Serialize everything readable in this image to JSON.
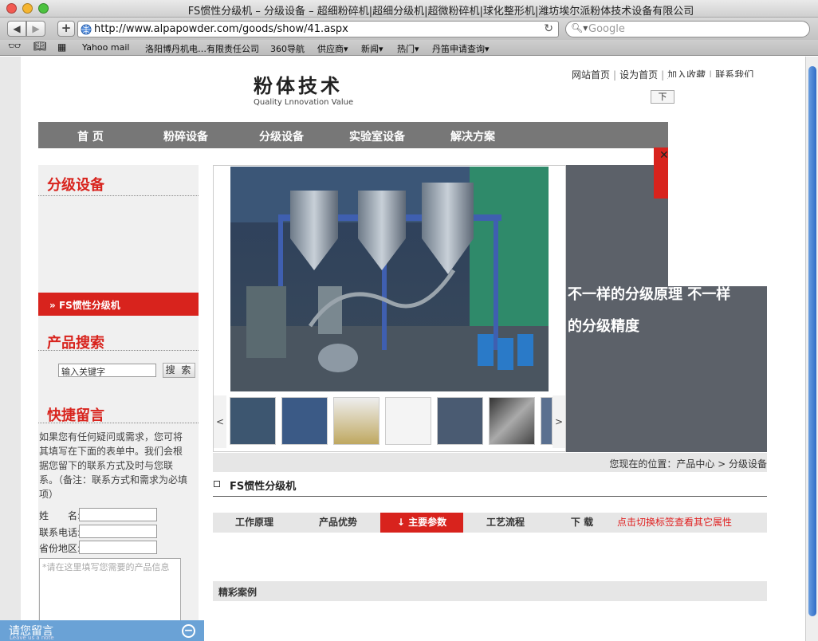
{
  "browser": {
    "title": "FS惯性分级机 – 分级设备 – 超细粉碎机|超细分级机|超微粉碎机|球化整形机|潍坊埃尔派粉体技术设备有限公司",
    "url": "http://www.alpapowder.com/goods/show/41.aspx",
    "search_placeholder": "Google",
    "bookmarks": [
      "Yahoo mail",
      "洛阳博丹机电…有限责任公司",
      "360导航",
      "供应商▾",
      "新闻▾",
      "热门▾",
      "丹笛申请查询▾"
    ]
  },
  "header": {
    "logo_title": "粉体技术",
    "logo_sub": "Quality Lnnovation Value",
    "links": [
      "网站首页",
      "设为首页",
      "加入收藏",
      "联系我们"
    ],
    "popup_btn": "下"
  },
  "nav": {
    "items": [
      "首 页",
      "粉碎设备",
      "分级设备",
      "实验室设备",
      "解决方案"
    ]
  },
  "sidebar": {
    "category_title": "分级设备",
    "active_category": "FS惯性分级机",
    "search_title": "产品搜索",
    "search_value": "输入关键字",
    "search_button": "搜 索",
    "message_title": "快捷留言",
    "message_desc": "如果您有任何疑问或需求，您可将其填写在下面的表单中。我们会根据您留下的联系方式及时与您联系。（备注：联系方式和需求为必填项）",
    "fields": [
      "姓　　名:",
      "联系电话:",
      "省份地区:"
    ],
    "textarea_placeholder": "*请在这里填写您需要的产品信息"
  },
  "float_bar": {
    "title": "请您留言",
    "subtitle": "Leave us a note",
    "minimize": "−"
  },
  "gallery": {
    "prev": "<",
    "next": ">",
    "slogan": "不一样的分级原理 不一样的分级精度"
  },
  "breadcrumb": "您现在的位置：产品中心 > 分级设备",
  "product": {
    "title": "FS惯性分级机",
    "tabs": [
      "工作原理",
      "产品优势",
      "↓ 主要参数",
      "工艺流程",
      "下 载"
    ],
    "tab_hint": "点击切换标签查看其它属性",
    "cases_title": "精彩案例"
  }
}
